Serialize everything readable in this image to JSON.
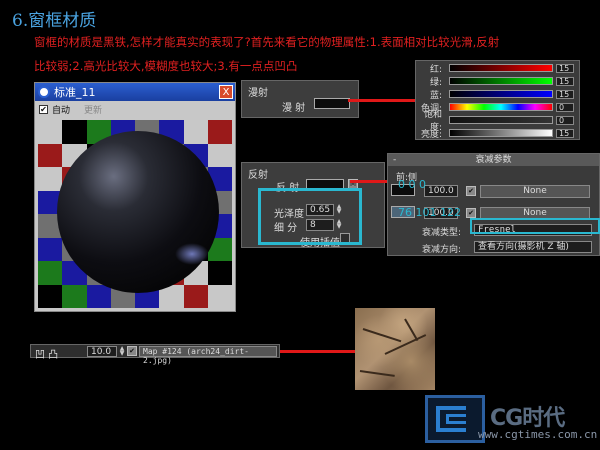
{
  "heading": "6.窗框材质",
  "desc_line1": "窗框的材质是黑铁,怎样才能真实的表现了?首先来看它的物理属性:1.表面相对比较光滑,反射",
  "desc_line2": "比较弱;2.高光比较大,模糊度也较大;3.有一点点凹凸",
  "preview": {
    "title": "标准_11",
    "close_label": "X",
    "auto_label": "自动",
    "update_label": "更新"
  },
  "diffuse": {
    "group_title": "漫射",
    "label": "漫 射"
  },
  "color_picker": {
    "rows": [
      {
        "label": "红:",
        "value": "15",
        "bar": "red"
      },
      {
        "label": "绿:",
        "value": "15",
        "bar": "green"
      },
      {
        "label": "蓝:",
        "value": "15",
        "bar": "blue"
      },
      {
        "label": "色调:",
        "value": "0",
        "bar": "hue"
      },
      {
        "label": "饱和度:",
        "value": "0",
        "bar": "sat"
      },
      {
        "label": "亮度:",
        "value": "15",
        "bar": "val"
      }
    ]
  },
  "reflect": {
    "group_title": "反射",
    "reflect_label": "反 射",
    "map_btn": "M",
    "gloss_label": "光泽度",
    "gloss_value": "0.65",
    "subdiv_label": "细 分",
    "subdiv_value": "8",
    "interp_label": "使用插值"
  },
  "falloff": {
    "header": "衰减参数",
    "front_side_label": "前:侧",
    "row1_value": "100.0",
    "row1_map": "None",
    "row2_value": "100.0",
    "row2_map": "None",
    "type_label": "衰减类型:",
    "type_value": "Fresnel",
    "dir_label": "衰减方向:",
    "dir_value": "查看方向(摄影机 Z 轴)",
    "overlay_1": "0 0 0",
    "overlay_2": "76 101 122"
  },
  "bump": {
    "label": "凹 凸",
    "value": "10.0",
    "map": "Map #124 (arch24_dirt-2.jpg)"
  },
  "logo": {
    "name": "CG时代",
    "url": "www.cgtimes.com.cn"
  }
}
